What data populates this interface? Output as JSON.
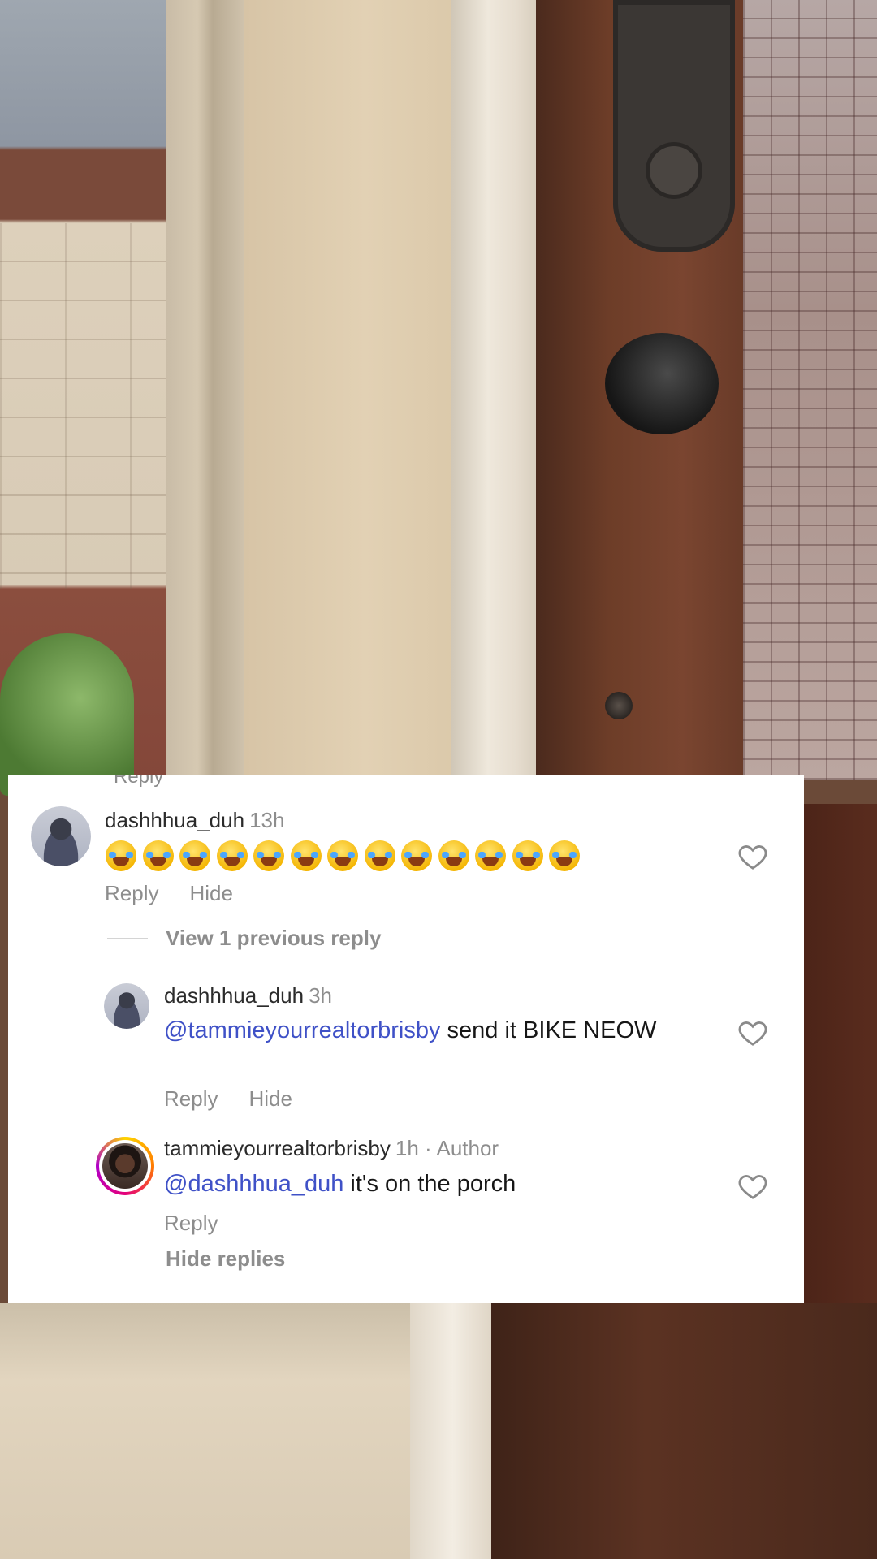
{
  "card_peek_text": "Reply",
  "comments": [
    {
      "username": "dashhhua_duh",
      "time": "13h",
      "emoji_count": 13,
      "emoji_name": "face-with-tears-of-joy-emoji",
      "actions": {
        "reply": "Reply",
        "hide": "Hide"
      }
    }
  ],
  "view_previous": "View 1 previous reply",
  "replies": [
    {
      "username": "dashhhua_duh",
      "time": "3h",
      "mention": "@tammieyourrealtorbrisby",
      "text": " send it BIKE NEOW",
      "actions": {
        "reply": "Reply",
        "hide": "Hide"
      }
    },
    {
      "username": "tammieyourrealtorbrisby",
      "time": "1h",
      "author_label": "· Author",
      "mention": "@dashhhua_duh",
      "text": " it's on the porch",
      "actions": {
        "reply": "Reply"
      }
    }
  ],
  "hide_replies": "Hide replies",
  "icons": {
    "like": "heart-outline-icon"
  },
  "colors": {
    "mention": "#3f51c7",
    "muted": "#8d8d8d",
    "author_ring": [
      "#ffd400",
      "#e4007a",
      "#b000c8"
    ]
  }
}
